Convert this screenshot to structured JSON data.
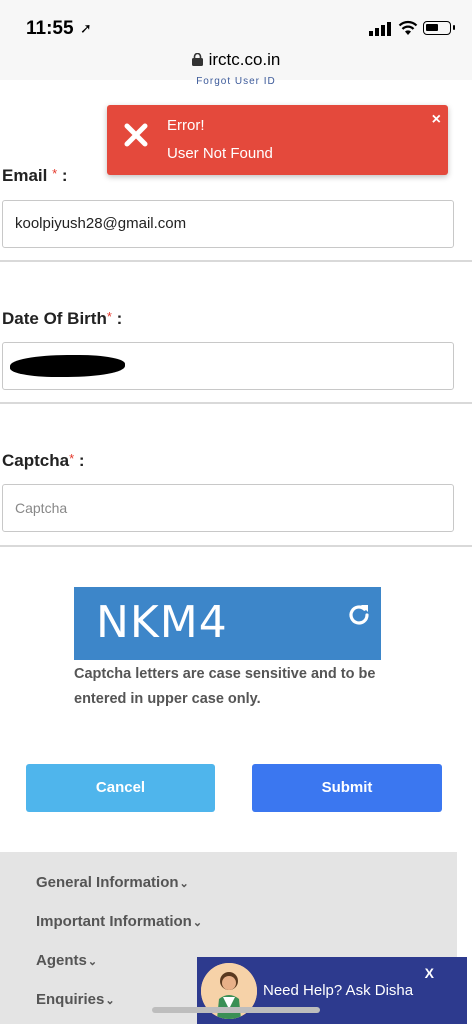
{
  "status_bar": {
    "time": "11:55",
    "url": "irctc.co.in"
  },
  "header": {
    "forgot_link": "Forgot User ID"
  },
  "error_toast": {
    "title": "Error!",
    "message": "User Not Found",
    "close": "×"
  },
  "form": {
    "email": {
      "label": "Email",
      "required": "*",
      "suffix": " :",
      "value": "koolpiyush28@gmail.com"
    },
    "dob": {
      "label": "Date Of Birth",
      "required": "*",
      "suffix": " :",
      "value": ""
    },
    "captcha": {
      "label": "Captcha",
      "required": "*",
      "suffix": " :",
      "placeholder": "Captcha"
    }
  },
  "captcha_image": {
    "text": "NKM4",
    "note": "Captcha letters are case sensitive and to be entered in upper case only."
  },
  "buttons": {
    "cancel": "Cancel",
    "submit": "Submit"
  },
  "footer": {
    "items": [
      "General Information",
      "Important Information",
      "Agents",
      "Enquiries"
    ]
  },
  "disha": {
    "text": "Need Help? Ask Disha",
    "close": "X"
  },
  "colors": {
    "error": "#e4493c",
    "cancel": "#4fb5ec",
    "submit": "#3b77f0",
    "captcha_bg": "#3d86c9"
  }
}
